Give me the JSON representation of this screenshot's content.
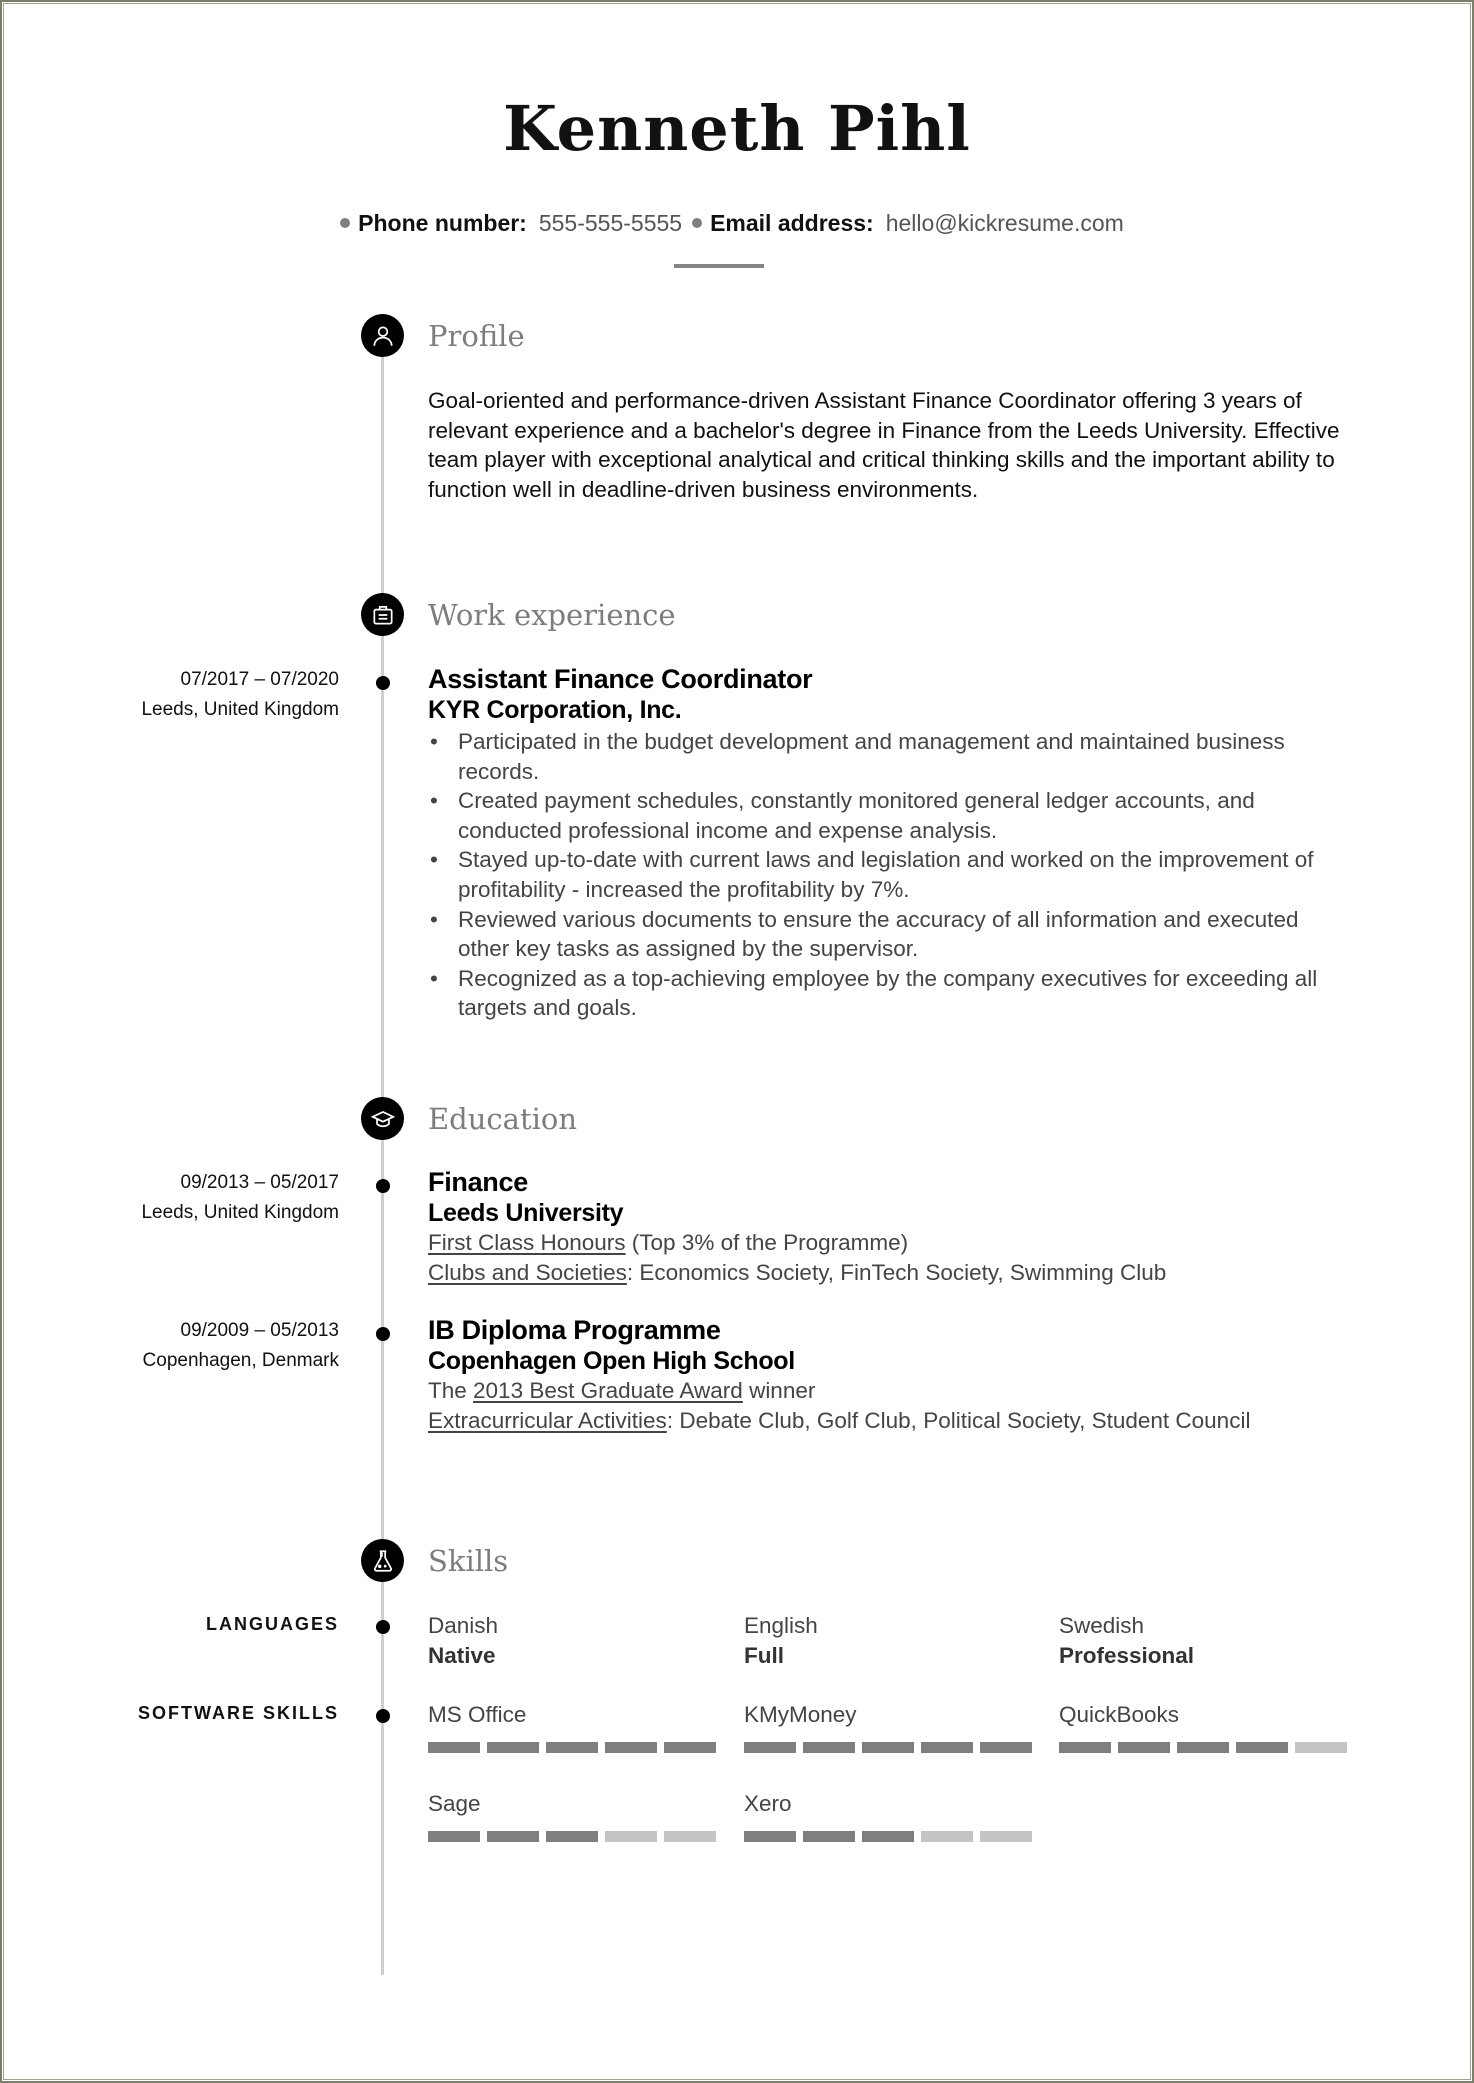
{
  "header": {
    "name": "Kenneth Pihl",
    "contacts": [
      {
        "label": "Phone number:",
        "value": "555-555-5555"
      },
      {
        "label": "Email address:",
        "value": "hello@kickresume.com"
      }
    ]
  },
  "profile": {
    "title": "Profile",
    "icon": "person-icon",
    "text": "Goal-oriented and performance-driven Assistant Finance Coordinator offering 3 years of relevant experience and a bachelor's degree in Finance from the Leeds University. Effective team player with exceptional analytical and critical thinking skills and the important ability to function well in deadline-driven business environments."
  },
  "work": {
    "title": "Work experience",
    "icon": "briefcase-icon",
    "jobs": [
      {
        "dates": "07/2017 – 07/2020",
        "location": "Leeds, United Kingdom",
        "position": "Assistant Finance Coordinator",
        "company": "KYR Corporation, Inc.",
        "bullets": [
          "Participated in the budget development and management and maintained business records.",
          "Created payment schedules, constantly monitored general ledger accounts, and conducted professional income and expense analysis.",
          "Stayed up-to-date with current laws and legislation and worked on the improvement of profitability - increased the profitability by 7%.",
          "Reviewed various documents to ensure the accuracy of all information and executed other key tasks as assigned by the supervisor.",
          "Recognized as a top-achieving employee by the company executives for exceeding all targets and goals."
        ]
      }
    ]
  },
  "education": {
    "title": "Education",
    "icon": "graduation-cap-icon",
    "entries": [
      {
        "dates": "09/2013 – 05/2017",
        "location": "Leeds, United Kingdom",
        "degree": "Finance",
        "school": "Leeds University",
        "line1_u": "First Class Honours",
        "line1_rest": " (Top 3% of the Programme)",
        "line2_u": "Clubs and Societies",
        "line2_rest": ": Economics Society, FinTech Society, Swimming Club"
      },
      {
        "dates": "09/2009 – 05/2013",
        "location": "Copenhagen, Denmark",
        "degree": "IB Diploma Programme",
        "school": "Copenhagen Open High School",
        "line1_pre": "The ",
        "line1_u": "2013 Best Graduate Award",
        "line1_rest": " winner",
        "line2_u": "Extracurricular Activities",
        "line2_rest": ": Debate Club, Golf Club, Political Society, Student Council"
      }
    ]
  },
  "skills": {
    "title": "Skills",
    "icon": "flask-icon",
    "languages_label": "LANGUAGES",
    "languages": [
      {
        "name": "Danish",
        "level": "Native"
      },
      {
        "name": "English",
        "level": "Full"
      },
      {
        "name": "Swedish",
        "level": "Professional"
      }
    ],
    "software_label": "SOFTWARE SKILLS",
    "software": [
      {
        "name": "MS Office",
        "rating": 5,
        "max": 5
      },
      {
        "name": "KMyMoney",
        "rating": 5,
        "max": 5
      },
      {
        "name": "QuickBooks",
        "rating": 4,
        "max": 5
      },
      {
        "name": "Sage",
        "rating": 3,
        "max": 5
      },
      {
        "name": "Xero",
        "rating": 3,
        "max": 5
      }
    ]
  }
}
